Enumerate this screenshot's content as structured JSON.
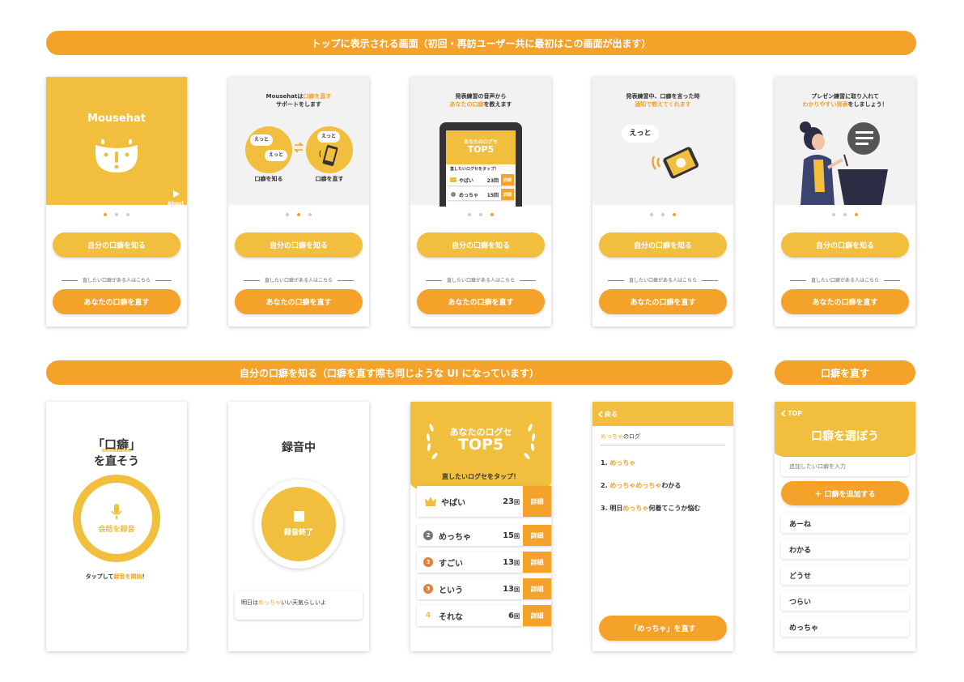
{
  "banners": {
    "top": "トップに表示される画面（初回・再訪ユーザー共に最初はこの画面が出ます）",
    "know": "自分の口癖を知る（口癖を直す際も同じような UI になっています）",
    "fix": "口癖を直す"
  },
  "colors": {
    "accent": "#f4a22a",
    "yellow": "#f2be3d"
  },
  "onboarding": {
    "btn_know": "自分の口癖を知る",
    "divider": "直したい口癖がある人はこちら",
    "btn_fix": "あなたの口癖を直す",
    "screen1": {
      "app_name": "Mousehat",
      "about": "About",
      "icon": "mouse-hat-logo-icon"
    },
    "screen2": {
      "line1_pre": "Mousehatは",
      "line1_hl": "口癖を直す",
      "line2": "サポートをします",
      "bubble_a": "えっと",
      "bubble_b": "えっと",
      "bubble_c": "えっと",
      "label_left": "口癖を知る",
      "label_right": "口癖を直す"
    },
    "screen3": {
      "line1": "発表練習の音声から",
      "line2_hl": "あなたの口癖",
      "line2_post": "を教えます",
      "phone_title1": "あなたのログセ",
      "phone_title2": "TOP5",
      "phone_prompt": "直したいログセをタップ！",
      "row1_word": "やばい",
      "row1_count": "23回",
      "row2_word": "めっちゃ",
      "row2_count": "15回",
      "detail": "詳細"
    },
    "screen4": {
      "line1": "発表練習中、口癖を言った時",
      "line2_hl": "通知で教えてくれます",
      "bubble": "えっと"
    },
    "screen5": {
      "line1": "プレゼン練習に取り入れて",
      "line2_hl": "わかりやすい発表",
      "line2_post": "をしましょう！"
    }
  },
  "record": {
    "title_bracket": "「口癖」",
    "title_line2": "を直そう",
    "button_label": "会話を録音",
    "hint_pre": "タップして",
    "hint_hl": "録音を開始",
    "hint_post": "！"
  },
  "recording": {
    "title": "録音中",
    "stop_label": "録音終了",
    "transcript_pre": "明日は",
    "transcript_hl": "めっちゃ",
    "transcript_post": "いい天気らしいよ"
  },
  "ranking": {
    "title1": "あなたのログセ",
    "title2": "TOP5",
    "prompt": "直したいログセをタップ！",
    "detail_label": "詳細",
    "rows": [
      {
        "rank": "1",
        "word": "やばい",
        "count": "23",
        "unit": "回"
      },
      {
        "rank": "2",
        "word": "めっちゃ",
        "count": "15",
        "unit": "回"
      },
      {
        "rank": "3",
        "word": "すごい",
        "count": "13",
        "unit": "回"
      },
      {
        "rank": "3",
        "word": "という",
        "count": "13",
        "unit": "回"
      },
      {
        "rank": "4",
        "word": "それな",
        "count": "6",
        "unit": "回"
      }
    ]
  },
  "log": {
    "back": "戻る",
    "heading_hl": "めっちゃ",
    "heading_post": "のログ",
    "items": [
      {
        "pre": "1. ",
        "hl": "めっちゃ",
        "post": ""
      },
      {
        "pre": "2. ",
        "hl": "めっちゃめっちゃ",
        "post": "わかる"
      },
      {
        "pre": "3. 明日",
        "hl": "めっちゃ",
        "post": "何着てこうか悩む"
      }
    ],
    "fix_button": "「めっちゃ」を直す"
  },
  "choose": {
    "back": "TOP",
    "title": "口癖を選ぼう",
    "input_placeholder": "追加したい口癖を入力",
    "add_button": "＋ 口癖を追加する",
    "items": [
      "あーね",
      "わかる",
      "どうせ",
      "つらい",
      "めっちゃ"
    ]
  }
}
